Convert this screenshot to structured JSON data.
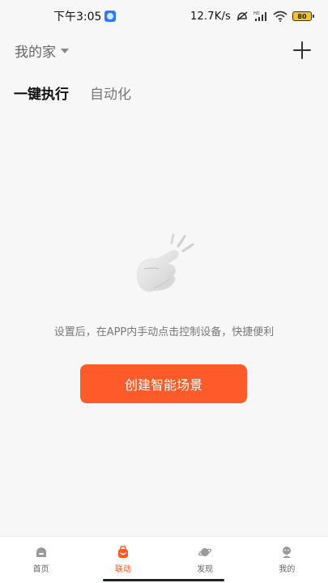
{
  "status_bar": {
    "time": "下午3:05",
    "net_speed": "12.7K/s",
    "network_badge": "HD",
    "battery": "80"
  },
  "header": {
    "home_name": "我的家"
  },
  "tabs": [
    {
      "label": "一键执行",
      "active": true
    },
    {
      "label": "自动化",
      "active": false
    }
  ],
  "empty_state": {
    "message": "设置后，在APP内手动点击控制设备，快捷便利",
    "button_label": "创建智能场景"
  },
  "bottom_nav": [
    {
      "label": "首页",
      "icon": "home-icon",
      "active": false
    },
    {
      "label": "联动",
      "icon": "linkage-icon",
      "active": true
    },
    {
      "label": "发现",
      "icon": "planet-icon",
      "active": false
    },
    {
      "label": "我的",
      "icon": "profile-icon",
      "active": false
    }
  ],
  "colors": {
    "accent": "#ff5a2a",
    "background": "#f7f7f7"
  }
}
